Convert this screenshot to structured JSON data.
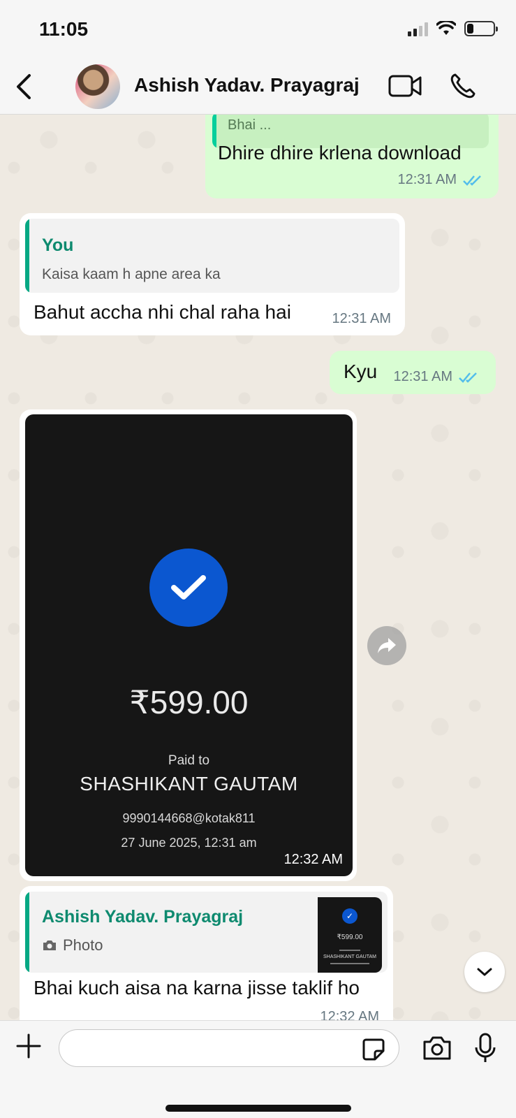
{
  "status_bar": {
    "time": "11:05",
    "battery_level": 0.25
  },
  "header": {
    "back_icon": "chevron-left-icon",
    "contact_name": "Ashish Yadav. Prayagraj",
    "video_icon": "video-camera-icon",
    "call_icon": "phone-icon"
  },
  "messages": [
    {
      "direction": "out",
      "quoted_preview": "Bhai ..."
    },
    {
      "direction": "out",
      "text": "Dhire dhire krlena download",
      "time": "12:31 AM",
      "status": "read"
    },
    {
      "direction": "in",
      "reply_to": {
        "author": "You",
        "text": "Kaisa kaam h apne area ka"
      },
      "text": "Bahut accha nhi chal raha hai",
      "time": "12:31 AM"
    },
    {
      "direction": "out",
      "text": "Kyu",
      "time": "12:31 AM",
      "status": "read"
    },
    {
      "direction": "in",
      "type": "image",
      "image": {
        "amount": "₹599.00",
        "paid_to_label": "Paid to",
        "payee": "SHASHIKANT GAUTAM",
        "upi_id": "9990144668@kotak811",
        "date": "27 June 2025, 12:31 am"
      },
      "time": "12:32 AM"
    },
    {
      "direction": "in",
      "reply_to": {
        "author": "Ashish Yadav. Prayagraj",
        "media_label": "Photo",
        "thumb_amount": "₹599.00",
        "thumb_payee": "SHASHIKANT GAUTAM"
      },
      "text": "Bhai kuch aisa na karna jisse taklif ho",
      "time": "12:32 AM"
    }
  ],
  "composer": {
    "placeholder": "",
    "plus_icon": "plus-icon",
    "sticker_icon": "sticker-icon",
    "camera_icon": "camera-icon",
    "mic_icon": "microphone-icon"
  },
  "colors": {
    "outgoing_bubble": "#d9fdd3",
    "incoming_bubble": "#ffffff",
    "read_ticks": "#53bdeb",
    "reply_accent": "#06a884",
    "payment_check": "#0b57d0"
  }
}
